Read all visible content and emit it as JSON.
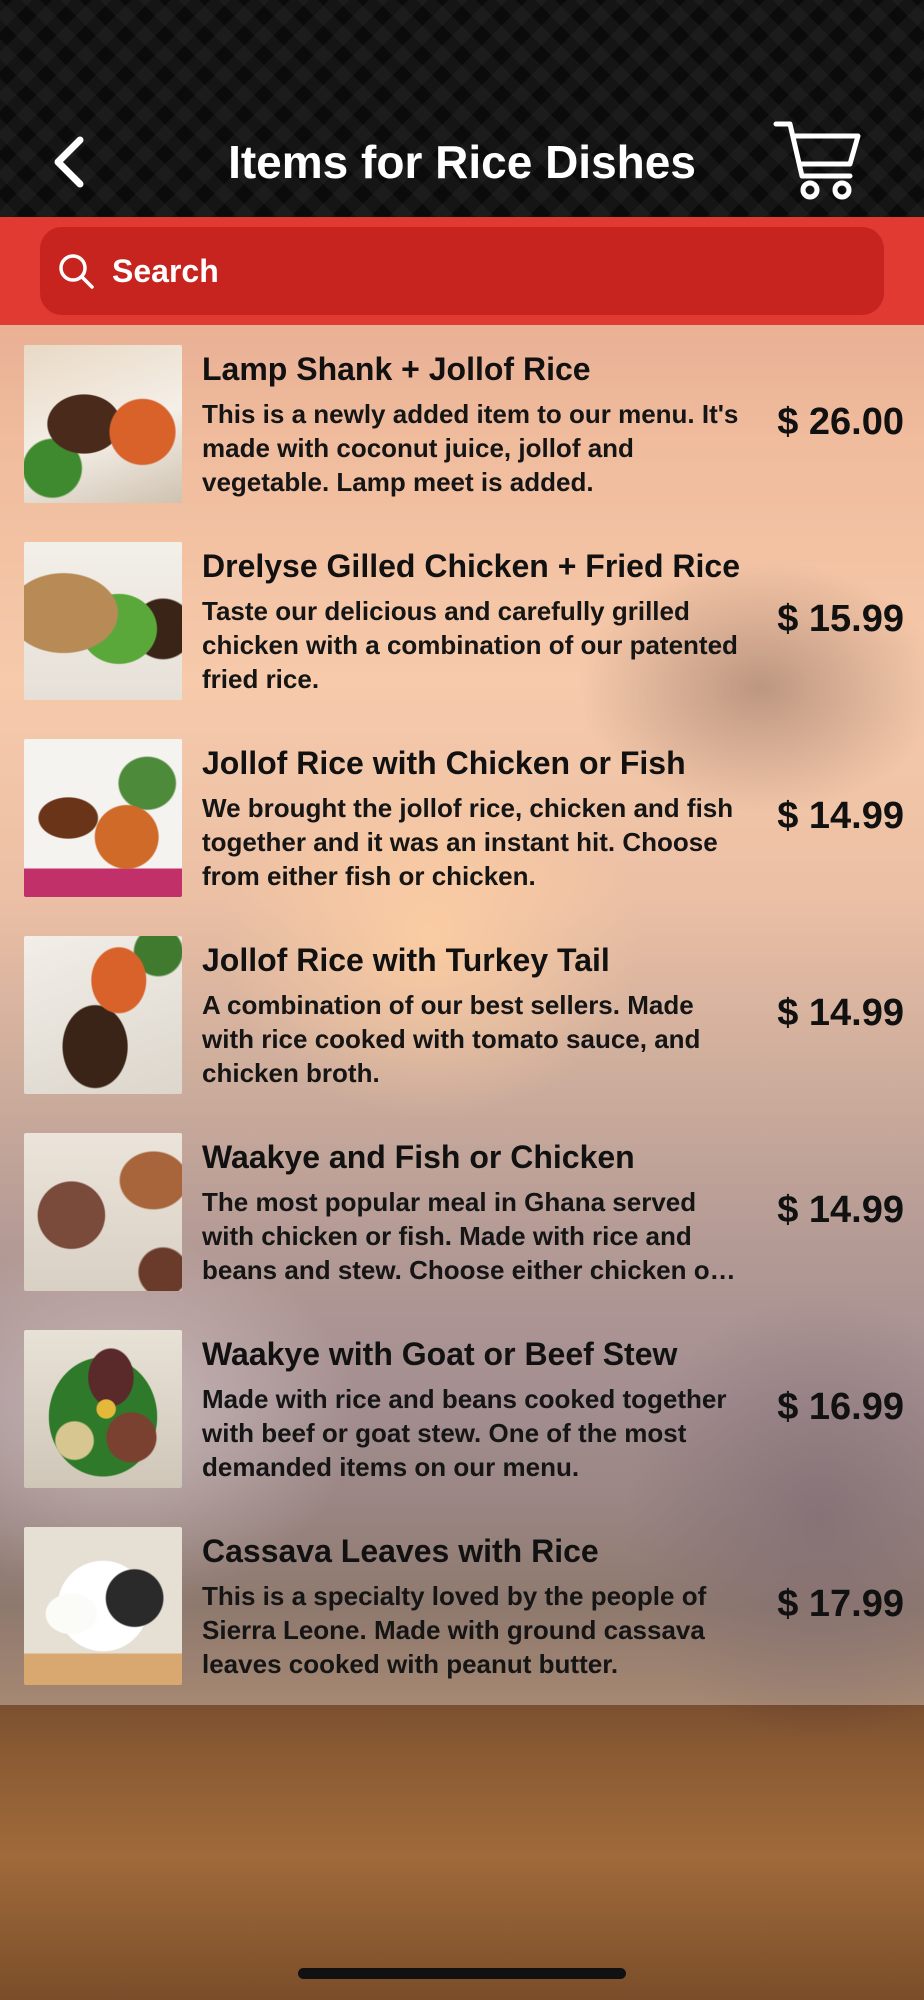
{
  "header": {
    "title": "Items for Rice Dishes",
    "back_icon": "chevron-left-icon",
    "cart_icon": "cart-icon"
  },
  "search": {
    "placeholder": "Search",
    "icon": "search-icon"
  },
  "colors": {
    "accent": "#e03a32",
    "search_field": "#c8241f",
    "header_bg": "#111111"
  },
  "items": [
    {
      "name": "Lamp Shank + Jollof Rice",
      "description": "This is a newly added item to our menu. It's made with coconut juice, jollof and vegetable. Lamp meet is added.",
      "price": "$ 26.00"
    },
    {
      "name": "Drelyse Gilled Chicken + Fried Rice",
      "description": "Taste our delicious and carefully grilled chicken with a combination of our patented fried rice.",
      "price": "$ 15.99"
    },
    {
      "name": "Jollof Rice with Chicken or Fish",
      "description": "We brought the jollof rice, chicken and fish together and it was an instant hit. Choose from either fish or chicken.",
      "price": "$ 14.99"
    },
    {
      "name": "Jollof Rice with Turkey Tail",
      "description": "A combination of our best sellers. Made with rice cooked with tomato sauce, and chicken broth.",
      "price": "$ 14.99"
    },
    {
      "name": "Waakye and Fish or Chicken",
      "description": "The most popular meal in Ghana served with chicken or fish. Made with rice and beans and stew. Choose either chicken or fish.",
      "price": "$ 14.99"
    },
    {
      "name": "Waakye with Goat or Beef Stew",
      "description": "Made with rice and beans cooked together with beef or goat stew. One of the most demanded items on our menu.",
      "price": "$ 16.99"
    },
    {
      "name": "Cassava Leaves with Rice",
      "description": "This is a specialty loved by the people of Sierra Leone. Made with ground cassava leaves cooked with peanut butter.",
      "price": "$ 17.99"
    }
  ]
}
